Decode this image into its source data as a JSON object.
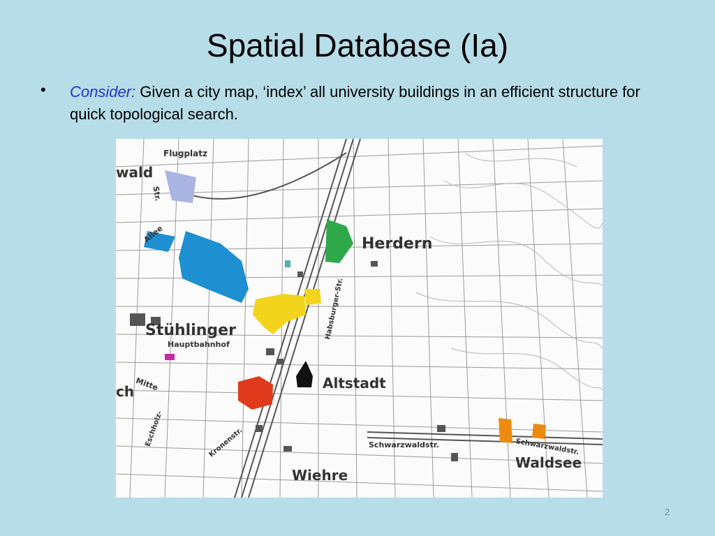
{
  "slide": {
    "title": "Spatial Database (Ia)",
    "bullet_marker": "•",
    "bullet_lead": "Consider:",
    "bullet_text": "Given a city map, ‘index’ all university buildings in an efficient structure for quick topological search.",
    "page_number": "2"
  },
  "map": {
    "labels": {
      "flugplatz": "Flugplatz",
      "wald": "wald",
      "allee": "Allee",
      "str_top": "Str.",
      "herdern": "Herdern",
      "stuhlinger": "Stühlinger",
      "hauptbahnhof": "Hauptbahnhof",
      "habsburger": "Habsburger-Str.",
      "altstadt": "Altstadt",
      "mitte": "Mitte",
      "ch": "ch",
      "eschholz": "Eschholz-",
      "kronenstr": "Kronenstr.",
      "schwarzwaldstr": "Schwarzwaldstr.",
      "schwarzwaldstr2": "Schwarzwaldstr.",
      "waldsee": "Waldsee",
      "wiehre": "Wiehre"
    },
    "colors": {
      "blue": "#1e8fd0",
      "green": "#2fa84a",
      "yellow": "#f2d41c",
      "red": "#e03a1c",
      "orange": "#ee8a10",
      "magenta": "#c42ba6",
      "periwinkle": "#a9b4e2",
      "teal": "#4fb3a6"
    }
  }
}
